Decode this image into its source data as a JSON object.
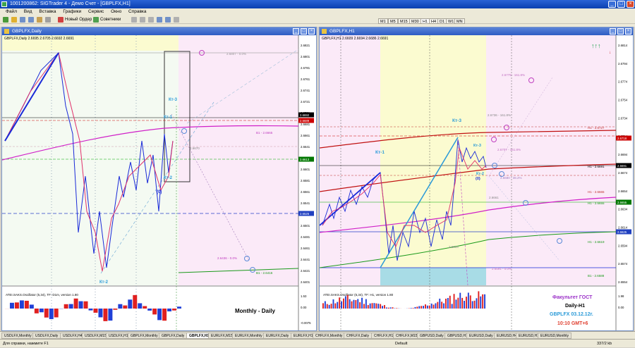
{
  "window": {
    "title": "1001200862: SIGTrader 4 - Демо Счет - [GBPLFX,H1]"
  },
  "menu": [
    "Файл",
    "Вид",
    "Вставка",
    "Графики",
    "Сервис",
    "Окно",
    "Справка"
  ],
  "toolbar": {
    "new_order": "Новый Ордер",
    "advisors": "Советники",
    "timeframes": [
      "M1",
      "M5",
      "M15",
      "M30",
      "H1",
      "H4",
      "D1",
      "W1",
      "MN"
    ]
  },
  "left_chart": {
    "title": "GBPLFX,Daily",
    "info": "GBPLFX,Daily 2.6695 2.6705 2.6692 2.6691",
    "indicator_label": "ATEI.SAKS.Oscillator (5,34), TF: D1m, version 1.80",
    "overlay_label": "Monthly - Daily",
    "price_labels": [
      "2.6821",
      "2.6801",
      "2.6781",
      "2.6761",
      "2.6741",
      "2.6721",
      "2.6701",
      "2.6681",
      "2.6661",
      "2.6641",
      "2.6621",
      "2.6601",
      "2.6581",
      "2.6561",
      "2.6541",
      "2.6521",
      "2.6501",
      "2.6481",
      "2.6461",
      "2.6441",
      "2.6421",
      "2.6401"
    ],
    "highlight_prices": [
      {
        "text": "2.6692",
        "color": "#000000"
      },
      {
        "text": "2.6689",
        "color": "#cc0000"
      },
      {
        "text": "2.6613",
        "color": "#007700"
      },
      {
        "text": "2.6525",
        "color": "#2040c0"
      }
    ],
    "level_labels": [
      "2.6807 - 0.0%",
      "B1 - 2.6665",
      "2.6670",
      "2.6436 - 0.0%",
      "B1 - 2.6416"
    ],
    "wave_labels": [
      "Кт-3",
      "Кт-1",
      "Кт-2",
      "(0)",
      "Кт-2"
    ],
    "osc_scale": [
      "1.53",
      "0.00",
      "-0.0075"
    ],
    "dates": [
      "18 Oct 2012",
      "24 Oct 2012",
      "30 Oct 2012",
      "5 Nov 2012",
      "9 Nov 2012",
      "15 Nov 2012",
      "21 Nov 2012",
      "27 Nov 2012",
      "3 Dec 2012"
    ]
  },
  "right_chart": {
    "title": "GBPLFX,H1",
    "info": "GBPLFX,H1 2.6609 2.6694 2.6686 2.6691",
    "indicator_label": "ATEI.SAKS.Oscillator (5,34), TF: H1, version 1.80",
    "price_labels": [
      "2.6814",
      "2.6794",
      "2.6774",
      "2.6754",
      "2.6734",
      "2.6714",
      "2.6694",
      "2.6674",
      "2.6654",
      "2.6634",
      "2.6614",
      "2.6594",
      "2.6574",
      "2.6554"
    ],
    "highlight_prices": [
      {
        "text": "2.6718",
        "color": "#cc0000"
      },
      {
        "text": "2.6691",
        "color": "#000000"
      },
      {
        "text": "2.6655",
        "color": "#007700"
      },
      {
        "text": "2.6625",
        "color": "#2040c0"
      }
    ],
    "level_labels": [
      "2.6779 - 161.8%",
      "2.6736 - 161.8%",
      "H1 - 2.6727",
      "2.6707 - 161.8%",
      "H1 - 2.6691",
      "2.6680 - 38.2%",
      "H1 - 2.6665",
      "2.6661",
      "H1 - 2.6655",
      "H1 - 2.6619",
      "2.6613",
      "2.6591 - 0.0%",
      "B1 - 2.6588"
    ],
    "wave_labels": [
      "Кт-3",
      "Кт-1",
      "Кт-3",
      "Кт-2",
      "(0)"
    ],
    "osc_scale": [
      "1.98",
      "0.00"
    ],
    "dates": [
      "29 Nov 2012",
      "30 Nov 06:00",
      "30 Nov 14:00",
      "30 Nov 22:00",
      "3 Dec 06:00",
      "3 Dec 14:00",
      "4 Dec 06:00",
      "4 Dec 14:00"
    ],
    "footer_lines": [
      {
        "text": "Факультет ГОСТ",
        "color": "#9b30c8"
      },
      {
        "text": "Daily-H1",
        "color": "#000000"
      },
      {
        "text": "GBPLFX 03.12.12г.",
        "color": "#2a9ad8"
      },
      {
        "text": "10:10 GMT+6",
        "color": "#e04030"
      }
    ]
  },
  "tabs": [
    "USDLFX,Monthly",
    "USDLFX,Daily",
    "USDLFX,H4",
    "USDLFX,M15",
    "USDLFX,H1",
    "GBPLFX,Monthly",
    "GBPLFX,Daily",
    "GBPLFX,H1",
    "EURLFX,M15",
    "EURLFX,Monthly",
    "EURLFX,Daily",
    "EURLFX,H1",
    "CHFLFX,Monthly",
    "CHFLFX,Daily",
    "CHFLFX,H1",
    "CHFLFX,M15",
    "GBPUSD,Daily",
    "GBPUSD,H1",
    "EURUSD,Daily",
    "EURUSD,H4",
    "EURUSD,H1",
    "EURUSD,Monthly"
  ],
  "active_tab": "GBPLFX,H1",
  "status": {
    "help": "Для справки, нажмите F1",
    "profile": "Default",
    "traffic": "337/2 kb"
  }
}
